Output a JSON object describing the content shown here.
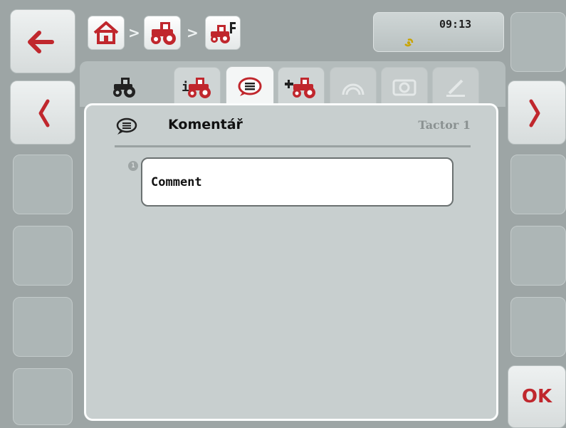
{
  "header": {
    "time": "09:13",
    "breadcrumb": [
      "home-icon",
      "tractor-icon",
      "tractor-implement-icon"
    ]
  },
  "tabs": [
    {
      "icon": "tractor-icon",
      "active": false
    },
    {
      "icon": "tractor-info-icon",
      "active": false
    },
    {
      "icon": "comment-icon",
      "active": true
    },
    {
      "icon": "tractor-connection-icon",
      "active": false
    },
    {
      "icon": "gauge-icon",
      "active": false,
      "disabled": true
    },
    {
      "icon": "camera-icon",
      "active": false,
      "disabled": true
    },
    {
      "icon": "pencil-icon",
      "active": false,
      "disabled": true
    }
  ],
  "panel": {
    "title": "Komentář",
    "subtitle": "Tactor 1",
    "field_index": "1",
    "field_value": "Comment"
  },
  "buttons": {
    "ok_label": "OK"
  },
  "colors": {
    "accent_red": "#c0272d",
    "panel_bg": "#c8cfcf",
    "frame_bg": "#9da5a5"
  }
}
